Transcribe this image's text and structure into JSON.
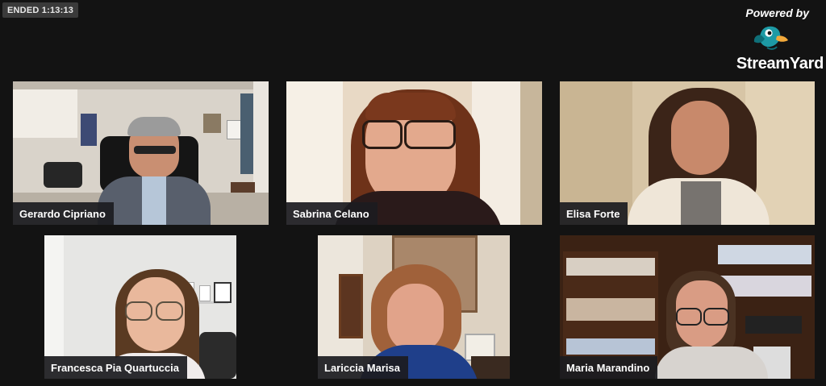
{
  "status": {
    "badge": "ENDED 1:13:13"
  },
  "branding": {
    "powered_by": "Powered by",
    "product": "StreamYard",
    "icon": "duck-logo-icon"
  },
  "participants": [
    {
      "name": "Gerardo Cipriano"
    },
    {
      "name": "Sabrina Celano"
    },
    {
      "name": "Elisa Forte"
    },
    {
      "name": "Francesca Pia Quartuccia"
    },
    {
      "name": "Lariccia Marisa"
    },
    {
      "name": "Maria Marandino"
    }
  ],
  "colors": {
    "background": "#131313",
    "label_bg": "#1c1c20",
    "badge_bg": "#3a3a3a",
    "logo_teal": "#1d9aa5",
    "logo_orange": "#f2a93b"
  }
}
